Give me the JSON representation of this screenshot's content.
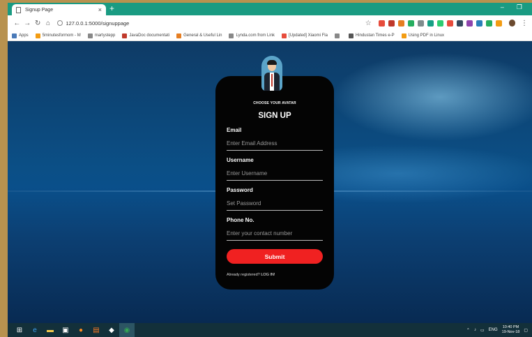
{
  "browser": {
    "tab_title": "Signup Page",
    "tab_close": "×",
    "new_tab": "+",
    "url": "127.0.0.1:5000/signuppage",
    "window_controls": [
      "–",
      "❐"
    ]
  },
  "bookmarks": [
    {
      "label": "Apps",
      "color": "#4a7ab8"
    },
    {
      "label": "5minutesformom - M",
      "color": "#f39c12"
    },
    {
      "label": "martystepp",
      "color": "#888888"
    },
    {
      "label": "JavaDoc documentati",
      "color": "#c0392b"
    },
    {
      "label": "General & Useful Lin",
      "color": "#e67e22"
    },
    {
      "label": "Lynda.com from Link",
      "color": "#888888"
    },
    {
      "label": "[Updated] Xiaomi Fla",
      "color": "#e74c3c"
    },
    {
      "label": "",
      "color": "#888888"
    },
    {
      "label": "Hindustan Times e-P",
      "color": "#555555"
    },
    {
      "label": "Using PDF in Linux",
      "color": "#f39c12"
    }
  ],
  "extensions": [
    "#e74c3c",
    "#c0392b",
    "#e67e22",
    "#27ae60",
    "#7f8c8d",
    "#16a085",
    "#2ecc71",
    "#e74c3c",
    "#34495e",
    "#8e44ad",
    "#2980b9",
    "#27ae60",
    "#f39c12"
  ],
  "form": {
    "avatar_hint": "CHOOSE YOUR AVATAR",
    "title": "SIGN UP",
    "email": {
      "label": "Email",
      "placeholder": "Enter Email Address"
    },
    "username": {
      "label": "Username",
      "placeholder": "Enter Username"
    },
    "password": {
      "label": "Password",
      "placeholder": "Set Password"
    },
    "phone": {
      "label": "Phone No.",
      "placeholder": "Enter your contact number"
    },
    "submit_label": "Submit",
    "login_prompt": "Already registered?",
    "login_link": "LOG IN!"
  },
  "taskbar": {
    "tray_lang": "ENG",
    "time": "10:40 PM",
    "date": "19-Nov-18"
  }
}
